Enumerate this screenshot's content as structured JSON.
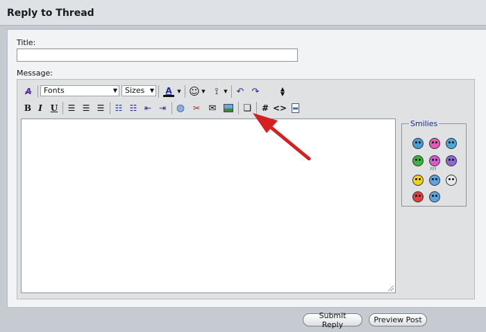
{
  "header": {
    "title": "Reply to Thread"
  },
  "form": {
    "title_label": "Title:",
    "title_value": "",
    "message_label": "Message:"
  },
  "toolbar": {
    "fonts_label": "Fonts",
    "sizes_label": "Sizes",
    "bold_label": "B",
    "italic_label": "I",
    "underline_label": "U",
    "hash_label": "#",
    "html_label": "<>"
  },
  "smilies": {
    "legend": "Smilies",
    "items": [
      {
        "name": "cool",
        "color": "#4a9bd6"
      },
      {
        "name": "tongue",
        "color": "#e05bb3"
      },
      {
        "name": "smile-blue",
        "color": "#4aa7d6"
      },
      {
        "name": "grin",
        "color": "#3bb53b"
      },
      {
        "name": "pink",
        "color": "#d85ad0"
      },
      {
        "name": "mad-purple",
        "color": "#8a6ad0"
      },
      {
        "name": "smile",
        "color": "#f0d020"
      },
      {
        "name": "confused",
        "color": "#5aa3e0"
      },
      {
        "name": "eek",
        "color": "#e8e8e8"
      },
      {
        "name": "angry",
        "color": "#e04040"
      },
      {
        "name": "roll-eyes",
        "color": "#5aa3e0"
      },
      {
        "name": "apple",
        "color": "#111111"
      }
    ],
    "confused_mark": "???"
  },
  "buttons": {
    "submit": "Submit Reply",
    "preview": "Preview Post"
  },
  "colors": {
    "accent_arrow": "#d42020",
    "smilies_legend": "#1b2b96"
  }
}
